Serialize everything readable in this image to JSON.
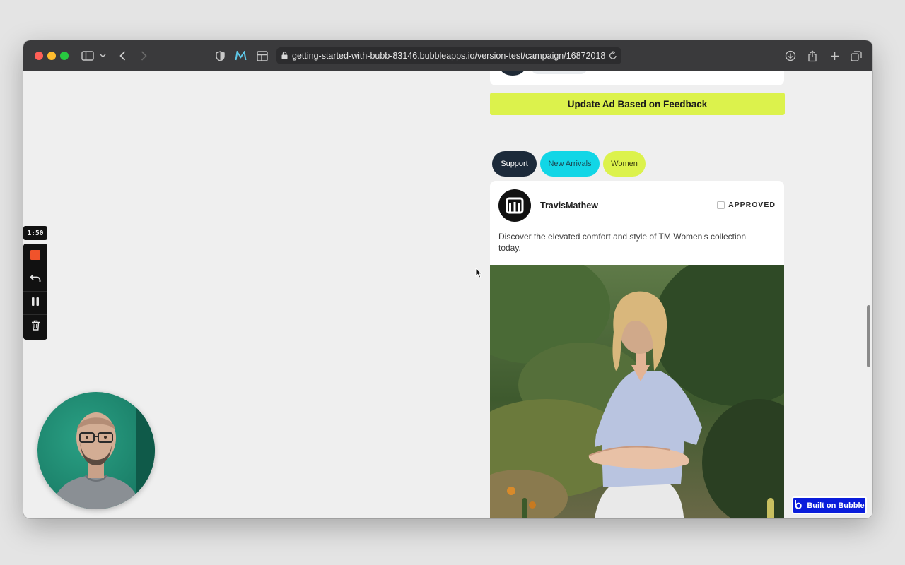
{
  "browser": {
    "url": "getting-started-with-bubb-83146.bubbleapps.io/version-test/campaign/168720188",
    "icons": [
      "sidebar-icon",
      "chevron-down-icon",
      "back-icon",
      "forward-icon",
      "shield-icon",
      "m-extension-icon",
      "layout-icon",
      "lock-icon",
      "reload-icon",
      "download-icon",
      "share-icon",
      "new-tab-icon",
      "tabs-overview-icon"
    ]
  },
  "main": {
    "update_button_label": "Update Ad Based on Feedback",
    "tags": [
      {
        "label": "Support",
        "color": "#1c2a3a"
      },
      {
        "label": "New Arrivals",
        "color": "#12d6e6"
      },
      {
        "label": "Women",
        "color": "#dcf24c"
      }
    ],
    "post": {
      "brand": "TravisMathew",
      "status": "APPROVED",
      "caption": "Discover the elevated comfort and style of TM Women's collection today."
    }
  },
  "recorder": {
    "timer": "1:50",
    "controls": [
      "stop-icon",
      "undo-icon",
      "pause-icon",
      "trash-icon"
    ]
  },
  "badge": {
    "label": "Built on Bubble"
  },
  "colors": {
    "accent_lime": "#dcf24c",
    "accent_cyan": "#12d6e6",
    "navy": "#1c2a3a",
    "bubble_blue": "#0a1ddb"
  }
}
